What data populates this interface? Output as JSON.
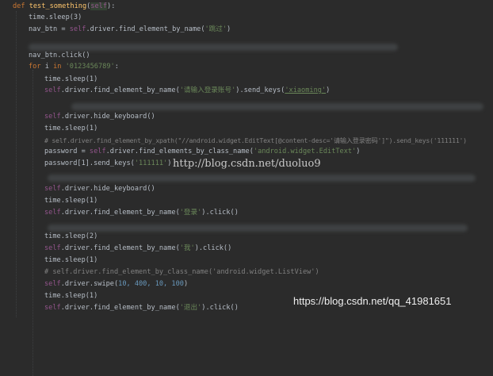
{
  "colors": {
    "background": "#2b2b2b",
    "keyword": "#cc7832",
    "self": "#94558d",
    "string": "#6a8759",
    "number": "#6897bb",
    "function": "#ffc66d",
    "comment": "#808080",
    "text": "#b7bec7"
  },
  "code": {
    "def_kw": "def ",
    "func_name": "test_something",
    "paren_open": "(",
    "param_self": "self",
    "paren_close_colon": "):",
    "sleep3": "time.sleep(3)",
    "nav_btn_assign": "nav_btn = ",
    "self_kw": "self",
    "find_by_name_call": ".driver.find_element_by_name(",
    "str_tiaoguo": "'跳过'",
    "close_paren": ")",
    "nav_click": "nav_btn.click()",
    "for_kw": "for ",
    "var_i": "i",
    "in_kw": " in ",
    "str_digits": "'0123456789'",
    "colon": ":",
    "sleep1": "time.sleep(1)",
    "str_account": "'请输入登录账号'",
    "send_keys_call": ").send_keys(",
    "str_xiaoming": "'xiaoming'",
    "hide_keyboard": ".driver.hide_keyboard()",
    "comment_xpath": "# self.driver.find_element_by_xpath(\"//android.widget.EditText[@content-desc='请输入登录密码']\").send_keys('111111')",
    "password_assign": "password = ",
    "find_by_class_call": ".driver.find_elements_by_class_name(",
    "str_edittext": "'android.widget.EditText'",
    "password_send": "password[1].send_keys(",
    "str_111111": "'111111'",
    "str_login": "'登录'",
    "click_call": ").click()",
    "sleep2": "time.sleep(2)",
    "str_me": "'我'",
    "comment_listview": "# self.driver.find_element_by_class_name('android.widget.ListView')",
    "swipe_call": ".driver.swipe(",
    "swipe_args": "10, 400, 10, 100",
    "str_logout": "'退出'"
  },
  "watermarks": {
    "blog_center": "http://blog.csdn.net/duoluo9",
    "blog_corner": "https://blog.csdn.net/qq_41981651"
  }
}
